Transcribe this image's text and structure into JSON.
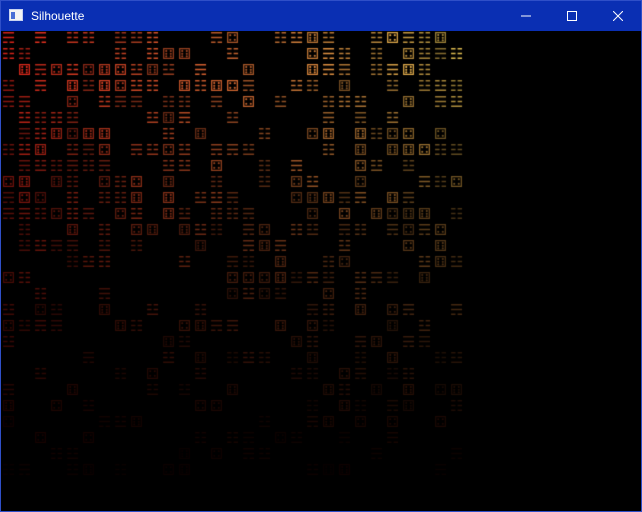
{
  "window": {
    "title": "Silhouette",
    "icon": "app-window-icon",
    "title_bar_color": "#0a2fb3",
    "border_color": "#2f4fc8"
  },
  "caption_buttons": [
    {
      "name": "minimize-button",
      "icon": "minimize-icon"
    },
    {
      "name": "maximize-button",
      "icon": "maximize-icon"
    },
    {
      "name": "close-button",
      "icon": "close-icon"
    }
  ],
  "canvas": {
    "background": "#000000",
    "glyphs": [
      "☷",
      "☳",
      "⚅",
      "⚃",
      "☴"
    ],
    "palette": {
      "top_left": "#ff2a1e",
      "top_right": "#ffe060",
      "bottom": "#5a0c04"
    }
  }
}
